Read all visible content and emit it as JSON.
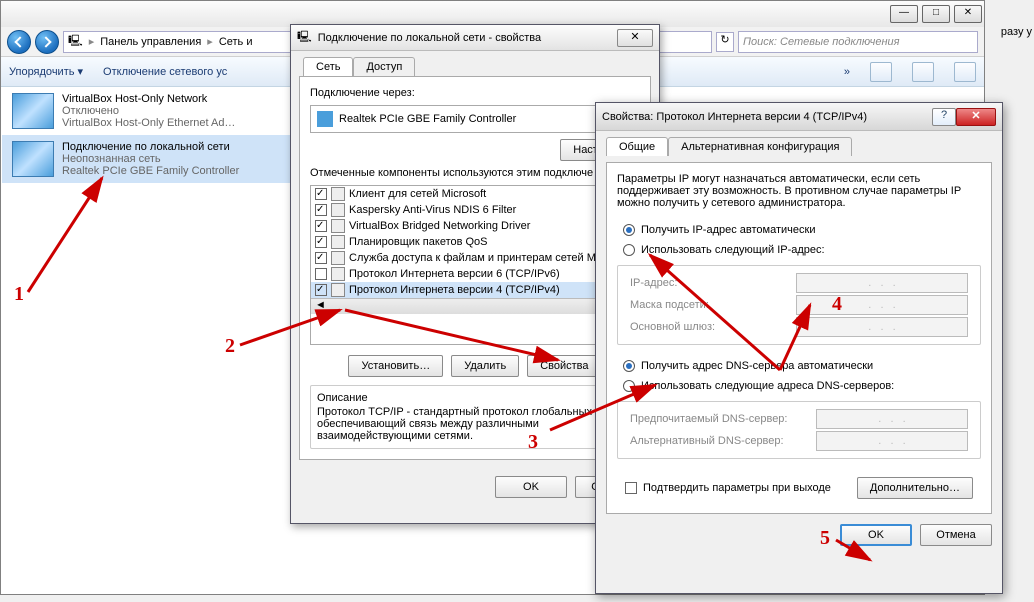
{
  "explorer": {
    "breadcrumbs": [
      "Панель управления",
      "Сеть и"
    ],
    "search_placeholder": "Поиск: Сетевые подключения",
    "toolbar": {
      "organize": "Упорядочить ▾",
      "disable": "Отключение сетевого ус"
    },
    "behind_text": "разу у",
    "connections": [
      {
        "title": "VirtualBox Host-Only Network",
        "status": "Отключено",
        "adapter": "VirtualBox Host-Only Ethernet Ad…",
        "selected": false
      },
      {
        "title": "Подключение по локальной сети",
        "status": "Неопознанная сеть",
        "adapter": "Realtek PCIe GBE Family Controller",
        "selected": true
      }
    ]
  },
  "props": {
    "title": "Подключение по локальной сети - свойства",
    "tabs": {
      "net": "Сеть",
      "access": "Доступ"
    },
    "connect_via_label": "Подключение через:",
    "adapter_name": "Realtek PCIe GBE Family Controller",
    "configure_btn": "Настроить",
    "components_text": "Отмеченные компоненты используются этим подключе",
    "items": [
      {
        "checked": true,
        "label": "Клиент для сетей Microsoft"
      },
      {
        "checked": true,
        "label": "Kaspersky Anti-Virus NDIS 6 Filter"
      },
      {
        "checked": true,
        "label": "VirtualBox Bridged Networking Driver"
      },
      {
        "checked": true,
        "label": "Планировщик пакетов QoS"
      },
      {
        "checked": true,
        "label": "Служба доступа к файлам и принтерам сетей Mi"
      },
      {
        "checked": false,
        "label": "Протокол Интернета версии 6 (TCP/IPv6)"
      },
      {
        "checked": true,
        "label": "Протокол Интернета версии 4 (TCP/IPv4)"
      }
    ],
    "install_btn": "Установить…",
    "remove_btn": "Удалить",
    "props_btn": "Свойства",
    "desc_label": "Описание",
    "desc_text": "Протокол TCP/IP - стандартный протокол глобальных сетей, обеспечивающий связь между различными взаимодействующими сетями.",
    "ok": "OK",
    "cancel": "Отмена"
  },
  "ipv4": {
    "title": "Свойства: Протокол Интернета версии 4 (TCP/IPv4)",
    "tabs": {
      "general": "Общие",
      "alt": "Альтернативная конфигурация"
    },
    "intro": "Параметры IP могут назначаться автоматически, если сеть поддерживает эту возможность. В противном случае параметры IP можно получить у сетевого администратора.",
    "auto_ip": "Получить IP-адрес автоматически",
    "use_ip": "Использовать следующий IP-адрес:",
    "ip_label": "IP-адрес:",
    "mask_label": "Маска подсети:",
    "gw_label": "Основной шлюз:",
    "auto_dns": "Получить адрес DNS-сервера автоматически",
    "use_dns": "Использовать следующие адреса DNS-серверов:",
    "dns1": "Предпочитаемый DNS-сервер:",
    "dns2": "Альтернативный DNS-сервер:",
    "confirm_exit": "Подтвердить параметры при выходе",
    "advanced": "Дополнительно…",
    "ok": "OK",
    "cancel": "Отмена"
  },
  "annotations": {
    "1": "1",
    "2": "2",
    "3": "3",
    "4": "4",
    "5": "5"
  }
}
